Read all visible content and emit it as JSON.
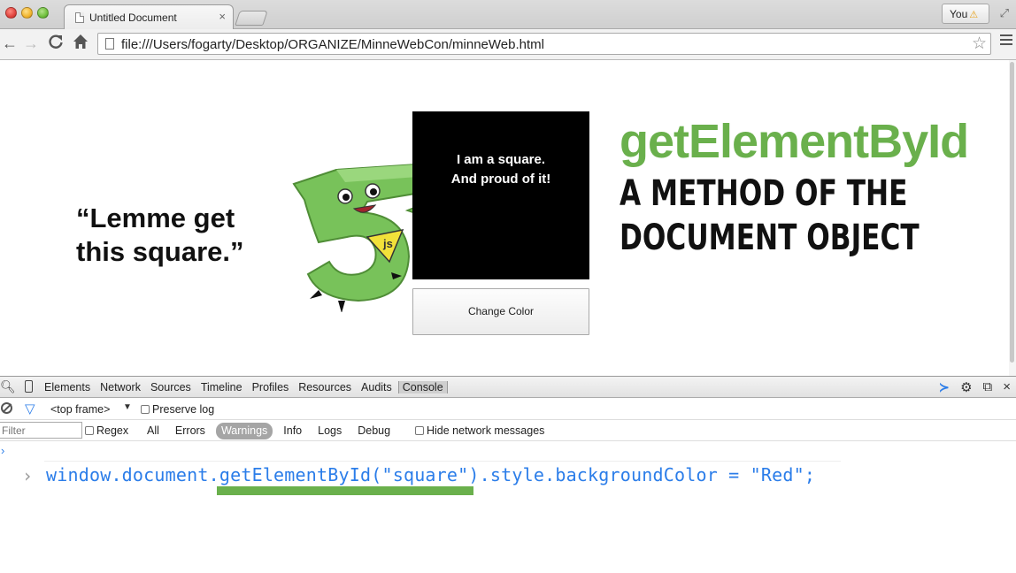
{
  "browser": {
    "tab_title": "Untitled Document",
    "tab_close": "×",
    "profile_label": "You",
    "url": "file:///Users/fogarty/Desktop/ORGANIZE/MinneWebCon/minneWeb.html"
  },
  "page": {
    "quote_line1": "“Lemme get",
    "quote_line2": "this square.”",
    "square_line1": "I am a square.",
    "square_line2": "And proud of it!",
    "button_label": "Change Color",
    "heading": "getElementById",
    "subheading_line1": "A METHOD OF THE",
    "subheading_line2": "DOCUMENT OBJECT",
    "mascot_badge": "js",
    "colors": {
      "accent_green": "#6ab04c",
      "square": "#000000",
      "console_blue": "#2b7de9"
    }
  },
  "devtools": {
    "tabs": [
      "Elements",
      "Network",
      "Sources",
      "Timeline",
      "Profiles",
      "Resources",
      "Audits",
      "Console"
    ],
    "selected_tab": "Console",
    "frame": "<top frame>",
    "preserve_log": "Preserve log",
    "filter_placeholder": "Filter",
    "regex": "Regex",
    "levels": [
      "All",
      "Errors",
      "Warnings",
      "Info",
      "Logs",
      "Debug"
    ],
    "active_level": "Warnings",
    "hide_network": "Hide network messages",
    "prompt": "›",
    "command": "window.document.getElementById(\"square\").style.backgroundColor = \"Red\";"
  }
}
